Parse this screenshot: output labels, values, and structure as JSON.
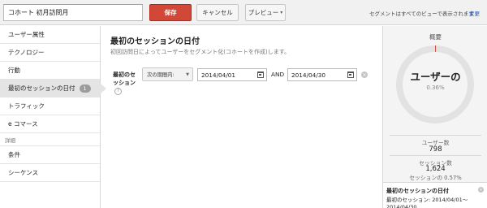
{
  "topbar": {
    "segment_name": "コホート 初月訪問月",
    "save_label": "保存",
    "cancel_label": "キャンセル",
    "preview_label": "プレビュー",
    "note": "セグメントはすべてのビューで表示されます",
    "change_link": "変更"
  },
  "sidebar": {
    "items": [
      {
        "label": "ユーザー属性"
      },
      {
        "label": "テクノロジー"
      },
      {
        "label": "行動"
      },
      {
        "label": "最初のセッションの日付",
        "badge": "1"
      },
      {
        "label": "トラフィック"
      },
      {
        "label": "e コマース"
      }
    ],
    "advanced_section": "詳細",
    "advanced_items": [
      {
        "label": "条件"
      },
      {
        "label": "シーケンス"
      }
    ]
  },
  "main": {
    "title": "最初のセッションの日付",
    "subtitle": "初回訪問日によってユーザーをセグメント化(コホートを作成)します。",
    "criterion_label": "最初のセッション",
    "help_glyph": "?",
    "operator": "次の期間内:",
    "date_start": "2014/04/01",
    "and_label": "AND",
    "date_end": "2014/04/30",
    "remove_glyph": "×"
  },
  "summary": {
    "title": "概要",
    "ring_label": "ユーザーの",
    "ring_percent": "0.36%",
    "ring_fraction": 0.0036,
    "users_label": "ユーザー数",
    "users_value": "798",
    "sessions_label": "セッション数",
    "sessions_value": "1,624",
    "sessions_percent": "セッションの 0.57%",
    "segment_title": "最初のセッションの日付",
    "segment_detail": "最初のセッション: 2014/04/01〜2014/04/30"
  },
  "colors": {
    "save_button": "#d14836",
    "link": "#1155cc",
    "ring_track": "#e2e2e2",
    "ring_fill": "#d14836",
    "active_item": "#e4e4e4"
  },
  "icons": [
    "calendar-icon",
    "help-icon",
    "remove-icon",
    "chevron-down-icon"
  ]
}
